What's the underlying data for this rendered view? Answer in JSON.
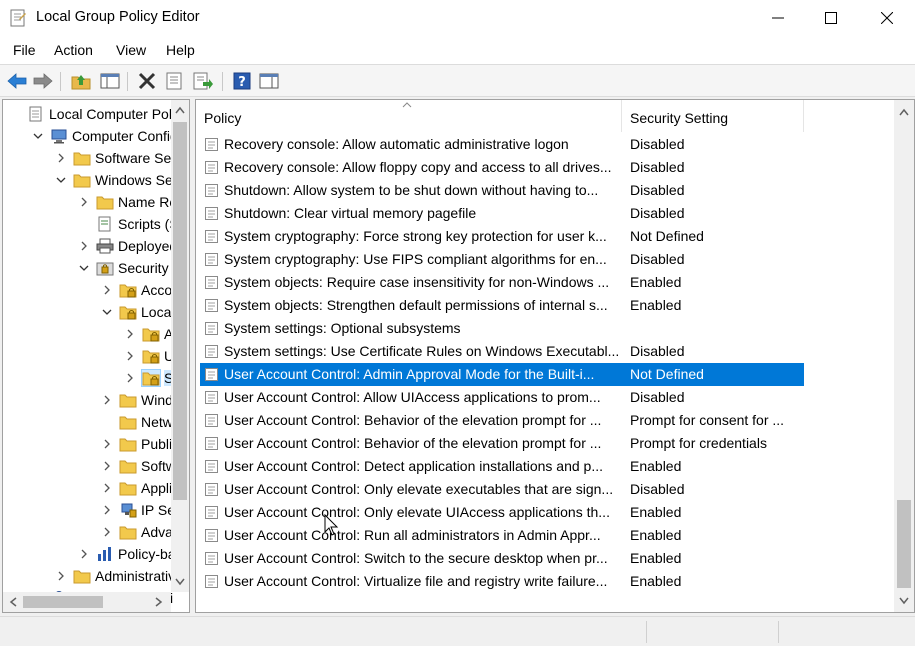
{
  "window": {
    "title": "Local Group Policy Editor"
  },
  "menu": [
    "File",
    "Action",
    "View",
    "Help"
  ],
  "toolbar": {
    "buttons": [
      "back-icon",
      "forward-icon",
      "up-folder-icon",
      "show-hide-tree-icon",
      "delete-icon",
      "properties-icon",
      "export-list-icon",
      "help-icon",
      "action-pane-icon"
    ]
  },
  "tree": {
    "items": [
      {
        "label": "Local Computer Polic",
        "level": 0,
        "arrow": "none",
        "icon": "policy-icon"
      },
      {
        "label": "Computer Configura",
        "level": 1,
        "arrow": "down",
        "icon": "computer-icon"
      },
      {
        "label": "Software Setti",
        "level": 2,
        "arrow": "right",
        "icon": "folder-icon"
      },
      {
        "label": "Windows Sett",
        "level": 2,
        "arrow": "down",
        "icon": "folder-icon"
      },
      {
        "label": "Name Res",
        "level": 3,
        "arrow": "right",
        "icon": "folder-icon"
      },
      {
        "label": "Scripts (Sta",
        "level": 3,
        "arrow": "none",
        "icon": "scripts-icon"
      },
      {
        "label": "Deployed",
        "level": 3,
        "arrow": "right",
        "icon": "printer-icon"
      },
      {
        "label": "Security Se",
        "level": 3,
        "arrow": "down",
        "icon": "security-icon"
      },
      {
        "label": "Accou",
        "level": 4,
        "arrow": "right",
        "icon": "locked-folder-icon"
      },
      {
        "label": "Local P",
        "level": 4,
        "arrow": "down",
        "icon": "locked-folder-icon"
      },
      {
        "label": "Au",
        "level": 5,
        "arrow": "right",
        "icon": "locked-folder-icon"
      },
      {
        "label": "Use",
        "level": 5,
        "arrow": "right",
        "icon": "locked-folder-icon"
      },
      {
        "label": "Sec",
        "level": 5,
        "arrow": "right",
        "icon": "locked-folder-icon",
        "selected": true
      },
      {
        "label": "Windo",
        "level": 4,
        "arrow": "right",
        "icon": "folder-icon"
      },
      {
        "label": "Netwo",
        "level": 4,
        "arrow": "none",
        "icon": "folder-icon"
      },
      {
        "label": "Public",
        "level": 4,
        "arrow": "right",
        "icon": "folder-icon"
      },
      {
        "label": "Softwa",
        "level": 4,
        "arrow": "right",
        "icon": "folder-icon"
      },
      {
        "label": "Applic",
        "level": 4,
        "arrow": "right",
        "icon": "folder-icon"
      },
      {
        "label": "IP Secu",
        "level": 4,
        "arrow": "right",
        "icon": "network-icon"
      },
      {
        "label": "Advan",
        "level": 4,
        "arrow": "right",
        "icon": "folder-icon"
      },
      {
        "label": "Policy-bas",
        "level": 3,
        "arrow": "right",
        "icon": "chart-icon"
      },
      {
        "label": "Administrative",
        "level": 2,
        "arrow": "right",
        "icon": "folder-icon"
      },
      {
        "label": "User Configuration",
        "level": 1,
        "arrow": "right",
        "icon": "user-icon"
      }
    ]
  },
  "list": {
    "columns": [
      "Policy",
      "Security Setting"
    ],
    "rows": [
      {
        "policy": "Recovery console: Allow automatic administrative logon",
        "setting": "Disabled"
      },
      {
        "policy": "Recovery console: Allow floppy copy and access to all drives...",
        "setting": "Disabled"
      },
      {
        "policy": "Shutdown: Allow system to be shut down without having to...",
        "setting": "Disabled"
      },
      {
        "policy": "Shutdown: Clear virtual memory pagefile",
        "setting": "Disabled"
      },
      {
        "policy": "System cryptography: Force strong key protection for user k...",
        "setting": "Not Defined"
      },
      {
        "policy": "System cryptography: Use FIPS compliant algorithms for en...",
        "setting": "Disabled"
      },
      {
        "policy": "System objects: Require case insensitivity for non-Windows ...",
        "setting": "Enabled"
      },
      {
        "policy": "System objects: Strengthen default permissions of internal s...",
        "setting": "Enabled"
      },
      {
        "policy": "System settings: Optional subsystems",
        "setting": ""
      },
      {
        "policy": "System settings: Use Certificate Rules on Windows Executabl...",
        "setting": "Disabled"
      },
      {
        "policy": "User Account Control: Admin Approval Mode for the Built-i...",
        "setting": "Not Defined",
        "selected": true
      },
      {
        "policy": "User Account Control: Allow UIAccess applications to prom...",
        "setting": "Disabled"
      },
      {
        "policy": "User Account Control: Behavior of the elevation prompt for ...",
        "setting": "Prompt for consent for ..."
      },
      {
        "policy": "User Account Control: Behavior of the elevation prompt for ...",
        "setting": "Prompt for credentials"
      },
      {
        "policy": "User Account Control: Detect application installations and p...",
        "setting": "Enabled"
      },
      {
        "policy": "User Account Control: Only elevate executables that are sign...",
        "setting": "Disabled"
      },
      {
        "policy": "User Account Control: Only elevate UIAccess applications th...",
        "setting": "Enabled"
      },
      {
        "policy": "User Account Control: Run all administrators in Admin Appr...",
        "setting": "Enabled"
      },
      {
        "policy": "User Account Control: Switch to the secure desktop when pr...",
        "setting": "Enabled"
      },
      {
        "policy": "User Account Control: Virtualize file and registry write failure...",
        "setting": "Enabled"
      }
    ]
  },
  "colors": {
    "selection": "#0078d7",
    "folder": "#e8b84a",
    "arrow_blue": "#1e6fc4"
  }
}
